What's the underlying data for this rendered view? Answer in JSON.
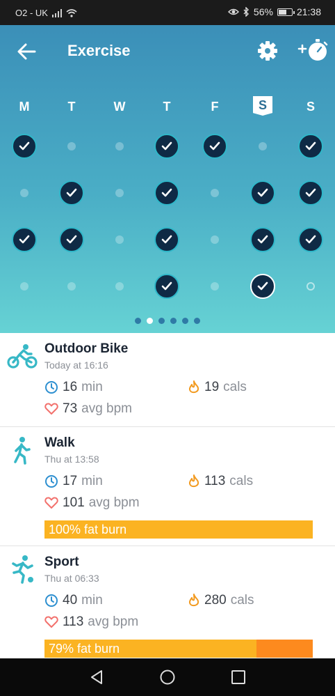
{
  "status": {
    "carrier": "O2 - UK",
    "battery": "56%",
    "time": "21:38"
  },
  "header": {
    "title": "Exercise"
  },
  "week": {
    "days": [
      "M",
      "T",
      "W",
      "T",
      "F",
      "S",
      "S"
    ],
    "today_index": 5,
    "rows": [
      [
        true,
        false,
        false,
        true,
        true,
        false,
        true
      ],
      [
        false,
        true,
        false,
        true,
        false,
        true,
        true
      ],
      [
        true,
        true,
        false,
        true,
        false,
        true,
        true
      ],
      [
        false,
        false,
        false,
        true,
        false,
        true,
        false
      ]
    ],
    "pages": 6,
    "active_page": 1
  },
  "activities": [
    {
      "name": "Outdoor Bike",
      "when": "Today at 16:16",
      "icon": "bike-icon",
      "duration": "16",
      "duration_unit": "min",
      "calories": "19",
      "calories_unit": "cals",
      "bpm": "73",
      "bpm_unit": "avg bpm",
      "fat_burn": "",
      "fat_burn_fraction": 0
    },
    {
      "name": "Walk",
      "when": "Thu at 13:58",
      "icon": "walk-icon",
      "duration": "17",
      "duration_unit": "min",
      "calories": "113",
      "calories_unit": "cals",
      "bpm": "101",
      "bpm_unit": "avg bpm",
      "fat_burn": "100% fat burn",
      "fat_burn_fraction": 1.0
    },
    {
      "name": "Sport",
      "when": "Thu at 06:33",
      "icon": "sport-icon",
      "duration": "40",
      "duration_unit": "min",
      "calories": "280",
      "calories_unit": "cals",
      "bpm": "113",
      "bpm_unit": "avg bpm",
      "fat_burn": "79% fat burn",
      "fat_burn_fraction": 0.79
    }
  ],
  "colors": {
    "hero_top": "#3b8fb8",
    "hero_bottom": "#66d2d4",
    "check_fill": "#0f2a45",
    "accent_teal": "#37b8c6",
    "fat_burn": "#fbb322",
    "fat_burn_rest": "#fd8a1e"
  }
}
